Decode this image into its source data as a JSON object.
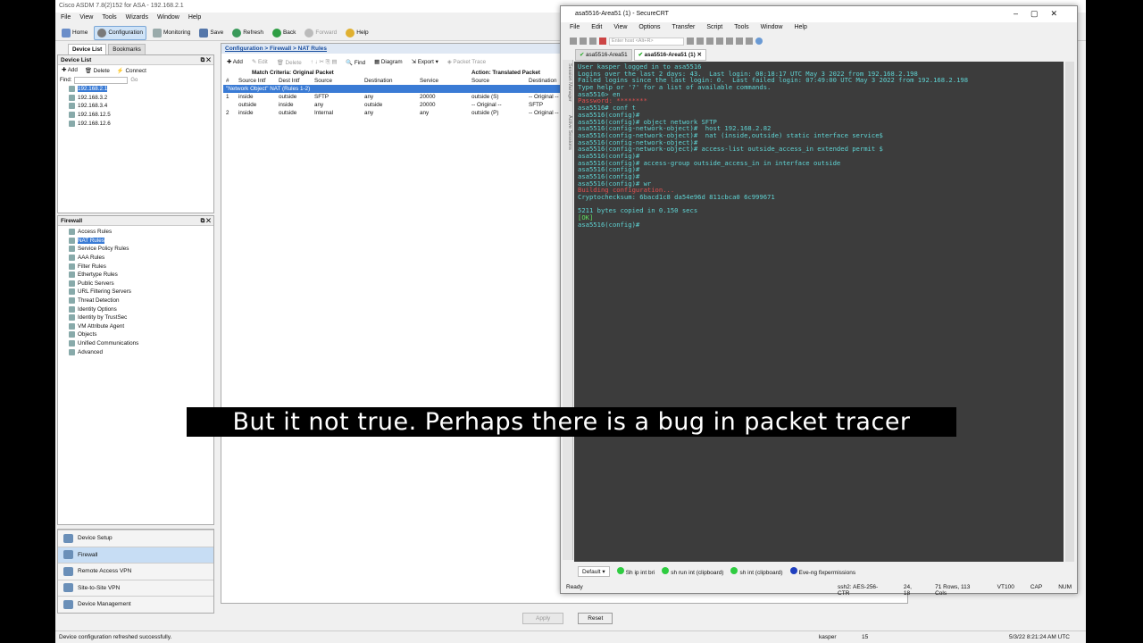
{
  "asdm": {
    "title": "Cisco ASDM 7.8(2)152 for ASA - 192.168.2.1",
    "menu": [
      "File",
      "View",
      "Tools",
      "Wizards",
      "Window",
      "Help"
    ],
    "toolbar": [
      "Home",
      "Configuration",
      "Monitoring",
      "Save",
      "Refresh",
      "Back",
      "Forward",
      "Help"
    ],
    "device_tabs": [
      "Device List",
      "Bookmarks"
    ],
    "device_list": {
      "title": "Device List",
      "actions": [
        "Add",
        "Delete",
        "Connect"
      ],
      "find_label": "Find:",
      "go_label": "Go",
      "devices": [
        "192.168.2.1",
        "192.168.3.2",
        "192.168.3.4",
        "192.168.12.5",
        "192.168.12.6"
      ]
    },
    "firewall": {
      "title": "Firewall",
      "items": [
        "Access Rules",
        "NAT Rules",
        "Service Policy Rules",
        "AAA Rules",
        "Filter Rules",
        "Ethertype Rules",
        "Public Servers",
        "URL Filtering Servers",
        "Threat Detection",
        "Identity Options",
        "Identity by TrustSec",
        "VM Attribute Agent",
        "Objects",
        "Unified Communications",
        "Advanced"
      ]
    },
    "nav": [
      "Device Setup",
      "Firewall",
      "Remote Access VPN",
      "Site-to-Site VPN",
      "Device Management"
    ],
    "breadcrumb": "Configuration > Firewall > NAT Rules",
    "nat_toolbar": [
      "Add",
      "Edit",
      "Delete",
      "Find",
      "Diagram",
      "Export",
      "Packet Trace"
    ],
    "nat_headers": {
      "match": "Match Criteria: Original Packet",
      "action": "Action: Translated Packet",
      "cols": [
        "#",
        "Source Intf",
        "Dest Intf",
        "Source",
        "Destination",
        "Service",
        "Source",
        "Destination"
      ]
    },
    "nat_group": "\"Network Object\" NAT (Rules 1-2)",
    "nat_rows": [
      [
        "1",
        "inside",
        "outside",
        "SFTP",
        "any",
        "20000",
        "outside (S)",
        "-- Original --"
      ],
      [
        "",
        "outside",
        "inside",
        "any",
        "outside",
        "20000",
        "-- Original --",
        "SFTP"
      ],
      [
        "2",
        "inside",
        "outside",
        "Internal",
        "any",
        "any",
        "outside (P)",
        "-- Original --"
      ]
    ],
    "apply": "Apply",
    "reset": "Reset",
    "status": "Device configuration refreshed successfully.",
    "status_user": "kasper",
    "status_num": "15",
    "status_time": "5/3/22 8:21:24 AM UTC"
  },
  "crt": {
    "title": "asa5516-Area51 (1) - SecureCRT",
    "menu": [
      "File",
      "Edit",
      "View",
      "Options",
      "Transfer",
      "Script",
      "Tools",
      "Window",
      "Help"
    ],
    "host_placeholder": "Enter host <Alt+R>",
    "tabs": [
      "asa5516-Area51",
      "asa5516-Area51 (1)"
    ],
    "side_labels": [
      "Session Manager",
      "Active Sessions"
    ],
    "lines": [
      {
        "t": "User kasper logged in to asa5516",
        "c": ""
      },
      {
        "t": "Logins over the last 2 days: 43.  Last login: 08:18:17 UTC May 3 2022 from 192.168.2.198",
        "c": ""
      },
      {
        "t": "Failed logins since the last login: 0.  Last failed login: 07:49:00 UTC May 3 2022 from 192.168.2.198",
        "c": ""
      },
      {
        "t": "Type help or '?' for a list of available commands.",
        "c": ""
      },
      {
        "t": "asa5516> en",
        "c": ""
      },
      {
        "t": "Password: ********",
        "c": "r"
      },
      {
        "t": "asa5516# conf t",
        "c": ""
      },
      {
        "t": "asa5516(config)#",
        "c": ""
      },
      {
        "t": "asa5516(config)# object network SFTP",
        "c": ""
      },
      {
        "t": "asa5516(config-network-object)#  host 192.168.2.82",
        "c": ""
      },
      {
        "t": "asa5516(config-network-object)#  nat (inside,outside) static interface service$",
        "c": ""
      },
      {
        "t": "asa5516(config-network-object)#",
        "c": ""
      },
      {
        "t": "asa5516(config-network-object)# access-list outside_access_in extended permit $",
        "c": ""
      },
      {
        "t": "asa5516(config)#",
        "c": ""
      },
      {
        "t": "asa5516(config)# access-group outside_access_in in interface outside",
        "c": ""
      },
      {
        "t": "asa5516(config)#",
        "c": ""
      },
      {
        "t": "asa5516(config)#",
        "c": ""
      },
      {
        "t": "asa5516(config)# wr",
        "c": ""
      },
      {
        "t": "Building configuration...",
        "c": "r"
      },
      {
        "t": "Cryptochecksum: 6bacd1c8 da54e96d 811cbca0 6c999671",
        "c": ""
      },
      {
        "t": "",
        "c": ""
      },
      {
        "t": "5211 bytes copied in 0.150 secs",
        "c": ""
      },
      {
        "t": "[OK]",
        "c": "g"
      },
      {
        "t": "asa5516(config)#",
        "c": ""
      }
    ],
    "buttons": [
      "Default",
      "Sh ip int bri",
      "sh run int (clipboard)",
      "sh int (clipboard)",
      "Eve-ng fixpermissions"
    ],
    "status": [
      "Ready",
      "ssh2: AES-256-CTR",
      "24, 18",
      "71 Rows, 113 Cols",
      "VT100",
      "CAP",
      "NUM"
    ]
  },
  "subtitle": "But it not true. Perhaps there is a bug in packet tracer"
}
